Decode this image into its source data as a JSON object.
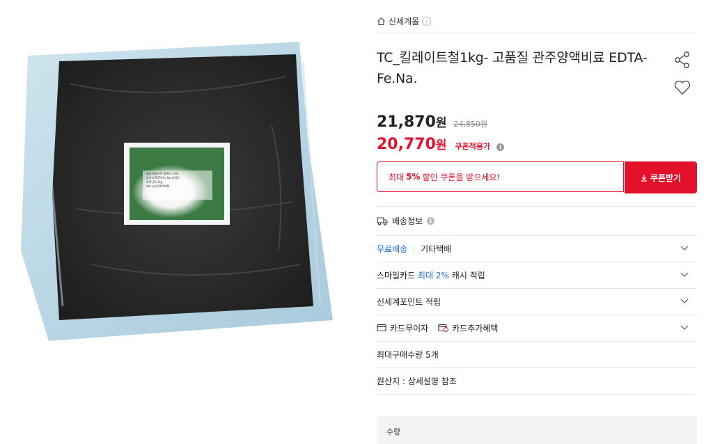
{
  "store": {
    "name": "신세계몰",
    "chevron_icon": "chevron-right-circle-icon"
  },
  "product": {
    "title": "TC_킬레이트철1kg- 고품질 관주양액비료 EDTA-Fe.Na.",
    "label_rows": [
      [
        "성분",
        "킬레이트 철(Fe) 13%"
      ],
      [
        "분자식",
        "EDTA-Fe.Na.3H2O"
      ],
      [
        "포장단위",
        "1kg"
      ],
      [
        "제조사",
        "JAOXCHEM"
      ]
    ]
  },
  "price": {
    "sale": "21,870",
    "sale_unit": "원",
    "original": "24,850원",
    "coupon": "20,770",
    "coupon_unit": "원",
    "coupon_label": "쿠폰적용가",
    "accent": "#e4112b"
  },
  "coupon_banner": {
    "prefix": "최대",
    "percent": "5%",
    "suffix": "할인 쿠폰을 받으세요!",
    "button": "쿠폰받기"
  },
  "shipping": {
    "label": "배송정보"
  },
  "rows": {
    "free_shipping": "무료배송",
    "courier": "기타택배",
    "smile_card": "스마일카드",
    "smile_max": "최대 2%",
    "smile_suffix": "캐시 적립",
    "ssg_point": "신세계포인트 적립",
    "card_free": "카드무이자",
    "card_extra": "카드추가혜택",
    "max_purchase": "최대구매수량 5개",
    "origin": "원산지 : 상세설명 참조"
  },
  "quantity": {
    "label": "수량"
  },
  "colors": {
    "link_blue": "#1a6dd4",
    "red": "#e4112b"
  }
}
